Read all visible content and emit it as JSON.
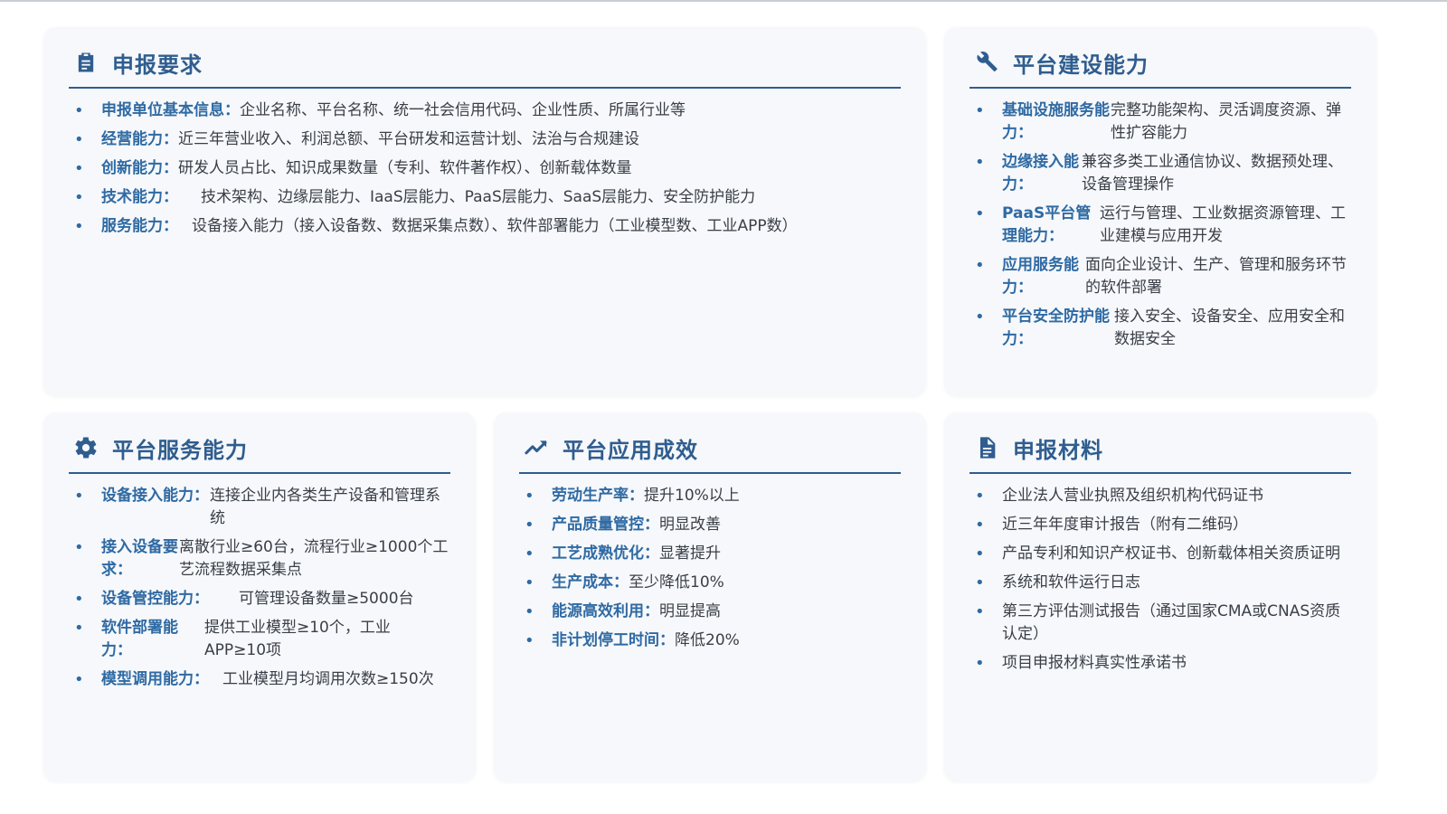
{
  "cards": {
    "requirements": {
      "title": "申报要求",
      "icon": "clipboard-icon",
      "items": [
        {
          "label": "申报单位基本信息：",
          "value": "企业名称、平台名称、统一社会信用代码、企业性质、所属行业等"
        },
        {
          "label": "经营能力：",
          "value": "近三年营业收入、利润总额、平台研发和运营计划、法治与合规建设"
        },
        {
          "label": "创新能力：",
          "value": "研发人员占比、知识成果数量（专利、软件著作权）、创新载体数量"
        },
        {
          "label": "技术能力：",
          "value": "技术架构、边缘层能力、IaaS层能力、PaaS层能力、SaaS层能力、安全防护能力"
        },
        {
          "label": "服务能力：",
          "value": "设备接入能力（接入设备数、数据采集点数）、软件部署能力（工业模型数、工业APP数）"
        }
      ]
    },
    "construction": {
      "title": "平台建设能力",
      "icon": "wrench-icon",
      "items": [
        {
          "label": "基础设施服务能力：",
          "value": "完整功能架构、灵活调度资源、弹性扩容能力"
        },
        {
          "label": "边缘接入能力：",
          "value": "兼容多类工业通信协议、数据预处理、设备管理操作"
        },
        {
          "label": "PaaS平台管理能力：",
          "value": "运行与管理、工业数据资源管理、工业建模与应用开发"
        },
        {
          "label": "应用服务能力：",
          "value": "面向企业设计、生产、管理和服务环节的软件部署"
        },
        {
          "label": "平台安全防护能力：",
          "value": "接入安全、设备安全、应用安全和数据安全"
        }
      ]
    },
    "service": {
      "title": "平台服务能力",
      "icon": "gear-icon",
      "items": [
        {
          "label": "设备接入能力：",
          "value": "连接企业内各类生产设备和管理系统"
        },
        {
          "label": "接入设备要求：",
          "value": "离散行业≥60台，流程行业≥1000个工艺流程数据采集点"
        },
        {
          "label": "设备管控能力：",
          "value": "可管理设备数量≥5000台"
        },
        {
          "label": "软件部署能力：",
          "value": "提供工业模型≥10个，工业APP≥10项"
        },
        {
          "label": "模型调用能力：",
          "value": "工业模型月均调用次数≥150次"
        }
      ]
    },
    "effects": {
      "title": "平台应用成效",
      "icon": "trend-up-icon",
      "items": [
        {
          "label": "劳动生产率：",
          "value": "提升10%以上"
        },
        {
          "label": "产品质量管控：",
          "value": "明显改善"
        },
        {
          "label": "工艺成熟优化：",
          "value": "显著提升"
        },
        {
          "label": "生产成本：",
          "value": "至少降低10%"
        },
        {
          "label": "能源高效利用：",
          "value": "明显提高"
        },
        {
          "label": "非计划停工时间：",
          "value": "降低20%"
        }
      ]
    },
    "materials": {
      "title": "申报材料",
      "icon": "document-icon",
      "items": [
        "企业法人营业执照及组织机构代码证书",
        "近三年年度审计报告（附有二维码）",
        "产品专利和知识产权证书、创新载体相关资质证明",
        "系统和软件运行日志",
        "第三方评估测试报告（通过国家CMA或CNAS资质认定）",
        "项目申报材料真实性承诺书"
      ]
    }
  },
  "colors": {
    "accent": "#2f5d8f",
    "label": "#2f6aa3",
    "card_bg": "#f6f8fb",
    "text": "#3a3f47"
  }
}
